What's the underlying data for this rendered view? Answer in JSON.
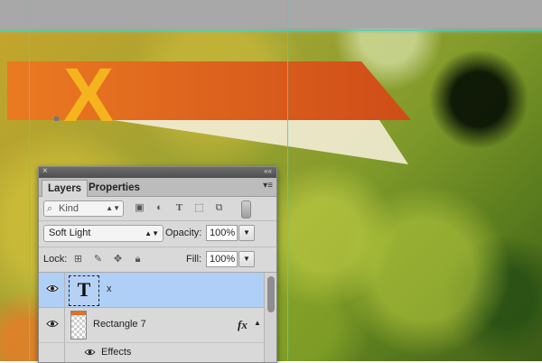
{
  "canvas": {
    "banner_letter": "X",
    "banner_color": "#d8561c",
    "guide_color": "#37d6c4"
  },
  "panel": {
    "close_glyph": "×",
    "collapse_glyph": "««",
    "tabs": [
      "Layers",
      "Properties"
    ],
    "menu_glyph": "▾≡",
    "filter": {
      "kind_label": "Kind",
      "icons": [
        "image-filter-icon",
        "adjustment-filter-icon",
        "type-filter-icon",
        "shape-filter-icon",
        "smart-object-filter-icon"
      ]
    },
    "blend_mode": "Soft Light",
    "opacity_label": "Opacity:",
    "opacity_value": "100%",
    "lock_label": "Lock:",
    "fill_label": "Fill:",
    "fill_value": "100%",
    "layers": [
      {
        "name": "x",
        "thumb": "T",
        "selected": true,
        "visible": true
      },
      {
        "name": "Rectangle 7",
        "fx": "fx",
        "selected": false,
        "visible": true
      }
    ],
    "effects_label": "Effects"
  }
}
